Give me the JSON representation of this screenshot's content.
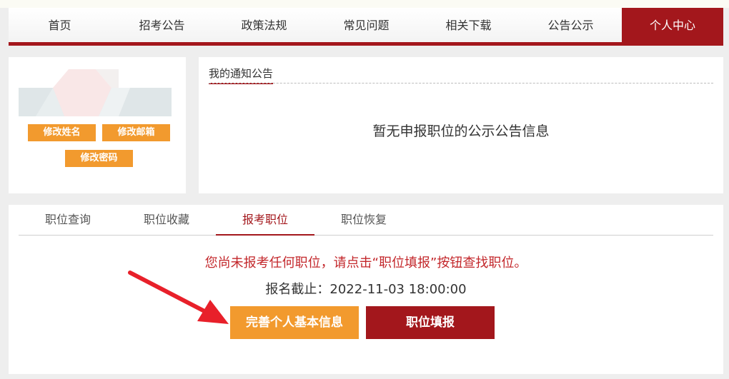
{
  "nav": {
    "items": [
      "首页",
      "招考公告",
      "政策法规",
      "常见问题",
      "相关下载",
      "公告公示"
    ],
    "active": "个人中心"
  },
  "profile": {
    "edit_name": "修改姓名",
    "edit_email": "修改邮箱",
    "edit_password": "修改密码"
  },
  "notice": {
    "title": "我的通知公告",
    "empty": "暂无申报职位的公示公告信息"
  },
  "jobs": {
    "tabs": [
      "职位查询",
      "职位收藏",
      "报考职位",
      "职位恢复"
    ],
    "active_tab": "报考职位",
    "message": "您尚未报考任何职位，请点击“职位填报”按钮查找职位。",
    "deadline": "报名截止：2022-11-03 18:00:00",
    "complete_info_button": "完善个人基本信息",
    "fill_job_button": "职位填报"
  },
  "colors": {
    "brand": "#a3171c",
    "orange": "#f29a2e",
    "alert_text": "#c3272b",
    "annotation_arrow": "#e8202a"
  },
  "icons": [
    "annotation-arrow-icon",
    "avatar-placeholder"
  ]
}
